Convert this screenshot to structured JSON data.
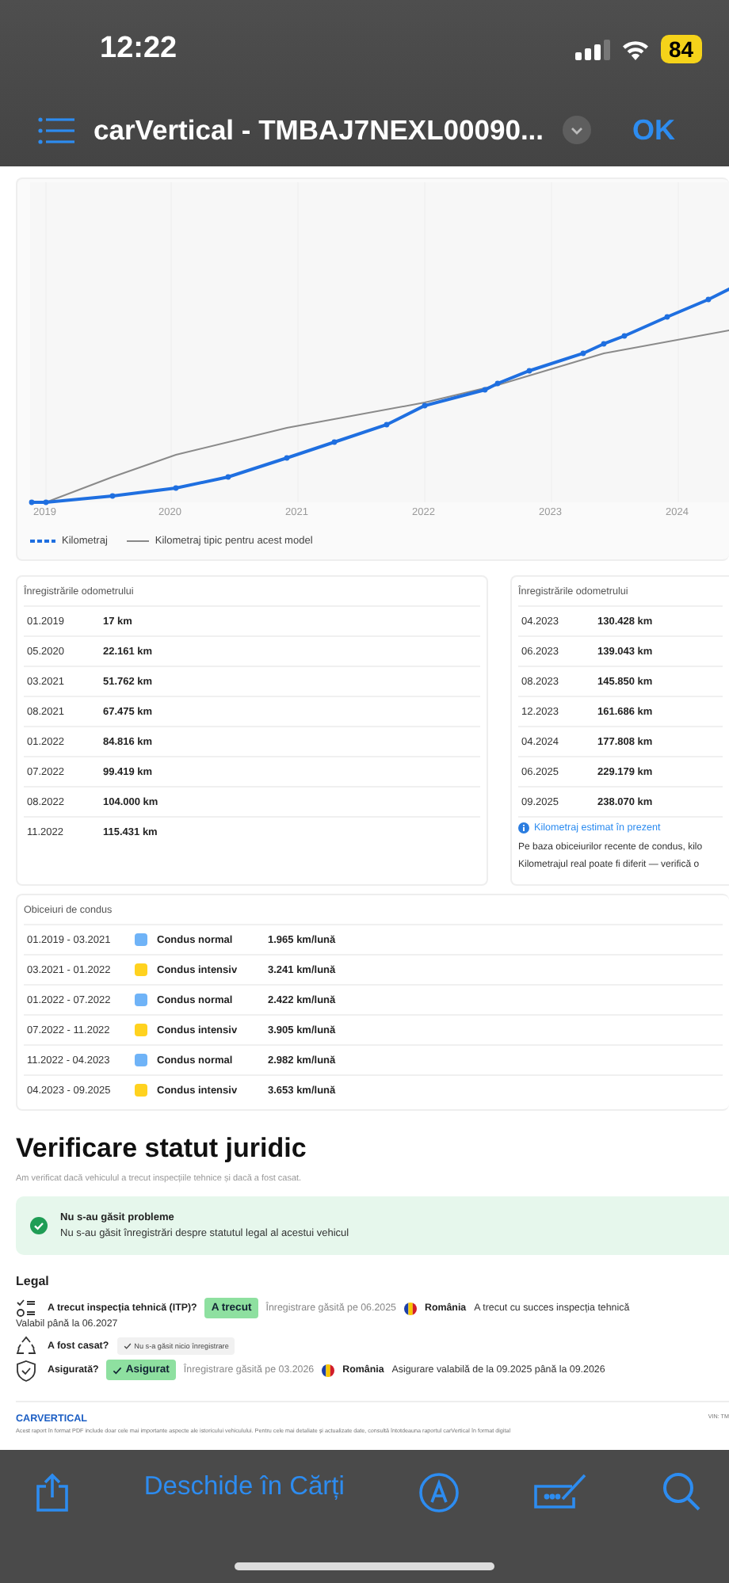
{
  "status_bar": {
    "time": "12:22",
    "battery": "84"
  },
  "nav_bar": {
    "title": "carVertical - TMBAJ7NEXL00090...",
    "done": "OK"
  },
  "mileage_chart": {
    "x_labels": [
      "2019",
      "2020",
      "2021",
      "2022",
      "2023",
      "2024"
    ],
    "legend": [
      {
        "label": "Kilometraj",
        "kind": "dashed"
      },
      {
        "label": "Kilometraj tipic pentru acest model",
        "kind": "solid"
      }
    ]
  },
  "odometer_tables": [
    {
      "title": "Înregistrările odometrului",
      "rows": [
        {
          "date": "01.2019",
          "km": "17 km"
        },
        {
          "date": "05.2020",
          "km": "22.161 km"
        },
        {
          "date": "03.2021",
          "km": "51.762 km"
        },
        {
          "date": "08.2021",
          "km": "67.475 km"
        },
        {
          "date": "01.2022",
          "km": "84.816 km"
        },
        {
          "date": "07.2022",
          "km": "99.419 km"
        },
        {
          "date": "08.2022",
          "km": "104.000 km"
        },
        {
          "date": "11.2022",
          "km": "115.431 km"
        }
      ]
    },
    {
      "title": "Înregistrările odometrului",
      "rows": [
        {
          "date": "04.2023",
          "km": "130.428 km"
        },
        {
          "date": "06.2023",
          "km": "139.043 km"
        },
        {
          "date": "08.2023",
          "km": "145.850 km"
        },
        {
          "date": "12.2023",
          "km": "161.686 km"
        },
        {
          "date": "04.2024",
          "km": "177.808 km"
        },
        {
          "date": "06.2025",
          "km": "229.179 km"
        },
        {
          "date": "09.2025",
          "km": "238.070 km"
        }
      ],
      "note": {
        "title": "Kilometraj estimat în prezent",
        "lines": [
          "Pe baza obiceiurilor recente de condus, kilo",
          "Kilometrajul real poate fi diferit — verifică o"
        ]
      }
    }
  ],
  "driving_habits": {
    "title": "Obiceiuri de condus",
    "rows": [
      {
        "period": "01.2019 - 03.2021",
        "color": "#6fb3f7",
        "label": "Condus normal",
        "rate": "1.965 km/lună"
      },
      {
        "period": "03.2021 - 01.2022",
        "color": "#ffd21f",
        "label": "Condus intensiv",
        "rate": "3.241 km/lună"
      },
      {
        "period": "01.2022 - 07.2022",
        "color": "#6fb3f7",
        "label": "Condus normal",
        "rate": "2.422 km/lună"
      },
      {
        "period": "07.2022 - 11.2022",
        "color": "#ffd21f",
        "label": "Condus intensiv",
        "rate": "3.905 km/lună"
      },
      {
        "period": "11.2022 - 04.2023",
        "color": "#6fb3f7",
        "label": "Condus normal",
        "rate": "2.982 km/lună"
      },
      {
        "period": "04.2023 - 09.2025",
        "color": "#ffd21f",
        "label": "Condus intensiv",
        "rate": "3.653 km/lună"
      }
    ]
  },
  "legal_section": {
    "title": "Verificare statut juridic",
    "subtitle": "Am verificat dacă vehiculul a trecut inspecțiile tehnice și dacă a fost casat.",
    "alert": {
      "title": "Nu s-au găsit probleme",
      "text": "Nu s-au găsit înregistrări despre statutul legal al acestui vehicul"
    },
    "heading": "Legal",
    "checks": [
      {
        "kind": "checklist",
        "question": "A trecut inspecția tehnică (ITP)?",
        "badge": {
          "text": "A trecut",
          "kind": "strong",
          "checkmark": false
        },
        "found": "Înregistrare găsită pe 06.2025",
        "country": "România",
        "detail": "A trecut cu succes inspecția tehnică",
        "extra": "Valabil până la 06.2027"
      },
      {
        "kind": "recycle",
        "question": "A fost casat?",
        "badge": {
          "text": "Nu s-a găsit nicio înregistrare",
          "kind": "subtle",
          "checkmark": true
        }
      },
      {
        "kind": "shield",
        "question": "Asigurată?",
        "badge": {
          "text": "Asigurat",
          "kind": "strong",
          "checkmark": true
        },
        "found": "Înregistrare găsită pe 03.2026",
        "country": "România",
        "detail": "Asigurare valabilă de la 09.2025 până la 09.2026"
      }
    ]
  },
  "footer": {
    "logo": "CARVERTICAL",
    "disclaimer": "Acest raport în format PDF include doar cele mai importante aspecte ale istoricului vehiculului. Pentru cele mai detaliate și actualizate date, consultă întotdeauna raportul carVertical în format digital",
    "vin": "VIN: TM"
  },
  "toolbar": {
    "open_in": "Deschide în Cărți"
  }
}
